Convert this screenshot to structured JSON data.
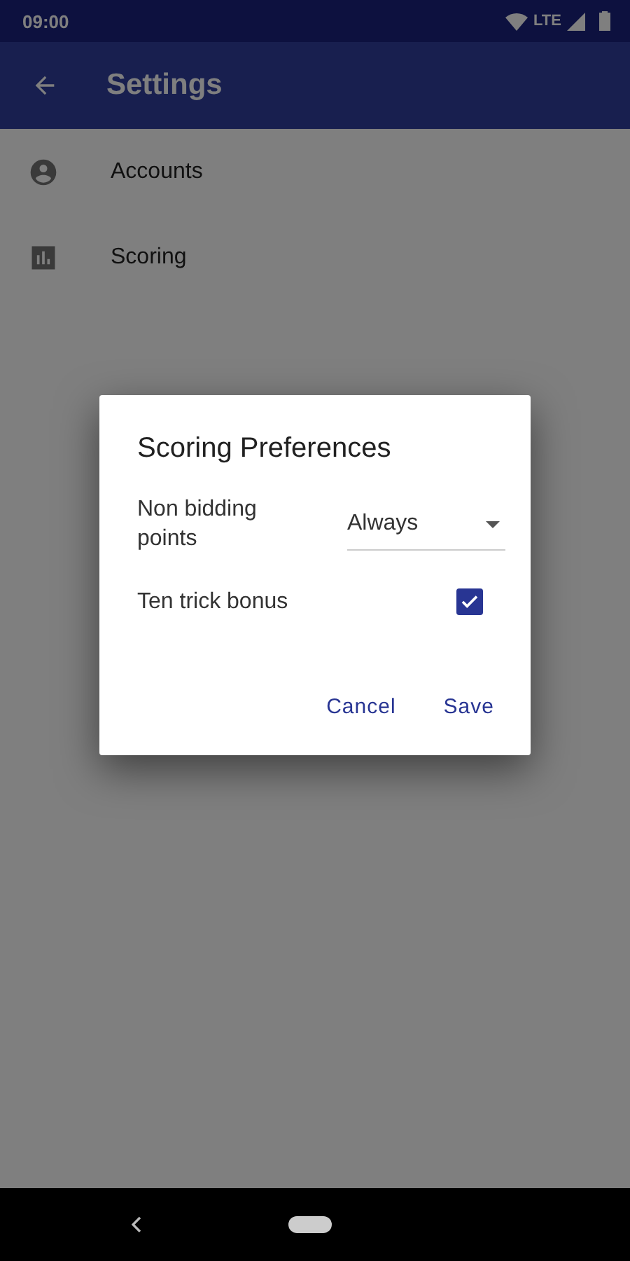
{
  "status_bar": {
    "time": "09:00",
    "network": "LTE"
  },
  "app_bar": {
    "title": "Settings"
  },
  "settings_items": [
    {
      "label": "Accounts",
      "kind": "account"
    },
    {
      "label": "Scoring",
      "kind": "chart"
    }
  ],
  "dialog": {
    "title": "Scoring Preferences",
    "rows": [
      {
        "kind": "dropdown",
        "label": "Non bidding points",
        "value": "Always"
      },
      {
        "kind": "checkbox",
        "label": "Ten trick bonus",
        "checked": true
      }
    ],
    "buttons": [
      "Cancel",
      "Save"
    ]
  }
}
